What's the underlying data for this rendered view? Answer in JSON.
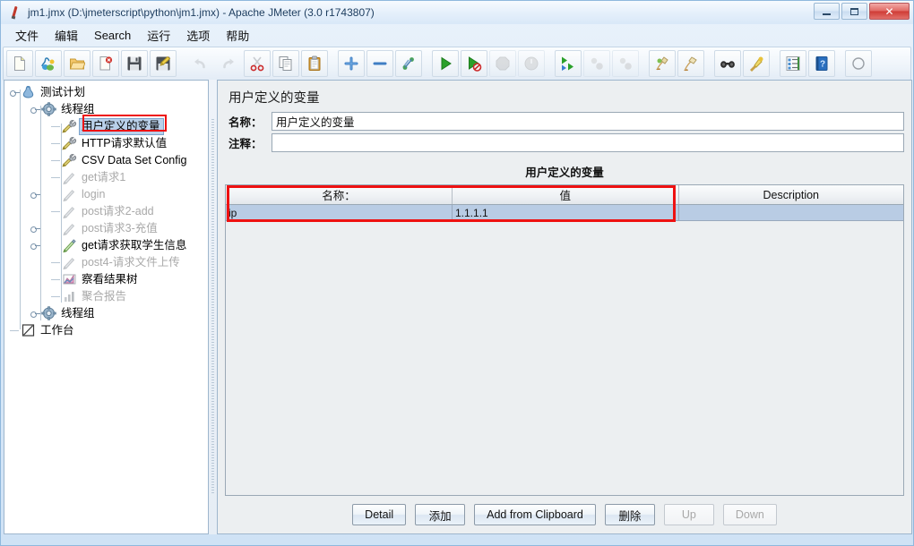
{
  "window": {
    "title": "jm1.jmx (D:\\jmeterscript\\python\\jm1.jmx) - Apache JMeter (3.0 r1743807)",
    "icon": "jmeter-feather-icon",
    "controls": {
      "minimize": "Minimize",
      "maximize": "Maximize",
      "close": "Close"
    }
  },
  "menubar": {
    "items": [
      {
        "label": "文件",
        "name": "menu-file"
      },
      {
        "label": "编辑",
        "name": "menu-edit"
      },
      {
        "label": "Search",
        "name": "menu-search"
      },
      {
        "label": "运行",
        "name": "menu-run"
      },
      {
        "label": "选项",
        "name": "menu-options"
      },
      {
        "label": "帮助",
        "name": "menu-help"
      }
    ]
  },
  "toolbar": {
    "buttons": [
      {
        "name": "new-icon",
        "enabled": true
      },
      {
        "name": "templates-icon",
        "enabled": true
      },
      {
        "name": "open-icon",
        "enabled": true
      },
      {
        "name": "close-icon",
        "enabled": true
      },
      {
        "name": "save-icon",
        "enabled": true
      },
      {
        "name": "save-as-icon",
        "enabled": true
      },
      {
        "name": "undo-icon",
        "enabled": false
      },
      {
        "name": "redo-icon",
        "enabled": false
      },
      {
        "name": "cut-icon",
        "enabled": true
      },
      {
        "name": "copy-icon",
        "enabled": true
      },
      {
        "name": "paste-icon",
        "enabled": true
      },
      {
        "name": "expand-all-icon",
        "enabled": true
      },
      {
        "name": "collapse-all-icon",
        "enabled": true
      },
      {
        "name": "toggle-icon",
        "enabled": true
      },
      {
        "name": "start-icon",
        "enabled": true
      },
      {
        "name": "start-no-pauses-icon",
        "enabled": true
      },
      {
        "name": "stop-icon",
        "enabled": false
      },
      {
        "name": "shutdown-icon",
        "enabled": false
      },
      {
        "name": "start-remote-all-icon",
        "enabled": true
      },
      {
        "name": "stop-remote-all-icon",
        "enabled": false
      },
      {
        "name": "shutdown-remote-all-icon",
        "enabled": false
      },
      {
        "name": "clear-icon",
        "enabled": true
      },
      {
        "name": "clear-all-icon",
        "enabled": true
      },
      {
        "name": "search-icon",
        "enabled": true
      },
      {
        "name": "search-reset-icon",
        "enabled": true
      },
      {
        "name": "function-helper-icon",
        "enabled": true
      },
      {
        "name": "help-icon",
        "enabled": true
      }
    ]
  },
  "tree": {
    "nodes": [
      {
        "label": "测试计划",
        "icon": "test-plan-icon",
        "depth": 0,
        "handle": "knob",
        "enabled": true,
        "selected": false
      },
      {
        "label": "线程组",
        "icon": "thread-group-icon",
        "depth": 1,
        "handle": "knob",
        "enabled": true,
        "selected": false
      },
      {
        "label": "用户定义的变量",
        "icon": "config-element-icon",
        "depth": 2,
        "handle": "leaf",
        "enabled": true,
        "selected": true
      },
      {
        "label": "HTTP请求默认值",
        "icon": "config-element-icon",
        "depth": 2,
        "handle": "leaf",
        "enabled": true,
        "selected": false
      },
      {
        "label": "CSV Data Set Config",
        "icon": "config-element-icon",
        "depth": 2,
        "handle": "leaf",
        "enabled": true,
        "selected": false
      },
      {
        "label": "get请求1",
        "icon": "http-sampler-icon",
        "depth": 2,
        "handle": "leaf",
        "enabled": false,
        "selected": false
      },
      {
        "label": "login",
        "icon": "http-sampler-icon",
        "depth": 2,
        "handle": "knob",
        "enabled": false,
        "selected": false
      },
      {
        "label": "post请求2-add",
        "icon": "http-sampler-icon",
        "depth": 2,
        "handle": "leaf",
        "enabled": false,
        "selected": false
      },
      {
        "label": "post请求3-充值",
        "icon": "http-sampler-icon",
        "depth": 2,
        "handle": "knob",
        "enabled": false,
        "selected": false
      },
      {
        "label": "get请求获取学生信息",
        "icon": "http-sampler-icon",
        "depth": 2,
        "handle": "knob",
        "enabled": true,
        "selected": false
      },
      {
        "label": "post4-请求文件上传",
        "icon": "http-sampler-icon",
        "depth": 2,
        "handle": "leaf",
        "enabled": false,
        "selected": false
      },
      {
        "label": "察看结果树",
        "icon": "view-results-tree-icon",
        "depth": 2,
        "handle": "leaf",
        "enabled": true,
        "selected": false
      },
      {
        "label": "聚合报告",
        "icon": "aggregate-report-icon",
        "depth": 2,
        "handle": "leaf",
        "enabled": false,
        "selected": false
      },
      {
        "label": "线程组",
        "icon": "thread-group-icon",
        "depth": 1,
        "handle": "knob",
        "enabled": true,
        "selected": false
      },
      {
        "label": "工作台",
        "icon": "workbench-icon",
        "depth": 0,
        "handle": "leaf",
        "enabled": true,
        "selected": false
      }
    ]
  },
  "panel": {
    "title": "用户定义的变量",
    "name_label": "名称：",
    "name_value": "用户定义的变量",
    "comment_label": "注释：",
    "comment_value": "",
    "table_caption": "用户定义的变量"
  },
  "table": {
    "columns": [
      "名称：",
      "值",
      "Description"
    ],
    "rows": [
      {
        "name": "ip",
        "value": "1.1.1.1",
        "description": ""
      }
    ]
  },
  "buttons": [
    {
      "label": "Detail",
      "name": "detail-button",
      "enabled": true
    },
    {
      "label": "添加",
      "name": "add-button",
      "enabled": true
    },
    {
      "label": "Add from Clipboard",
      "name": "add-from-clipboard-button",
      "enabled": true
    },
    {
      "label": "删除",
      "name": "delete-button",
      "enabled": true
    },
    {
      "label": "Up",
      "name": "up-button",
      "enabled": false
    },
    {
      "label": "Down",
      "name": "down-button",
      "enabled": false
    }
  ],
  "annotations": {
    "accent_color": "#ee1111",
    "boxes": [
      "tree-selected-node-highlight",
      "table-name-value-columns-highlight"
    ]
  },
  "colors": {
    "selection_blue": "#b9cce4",
    "tree_selection": "#b9d0ea",
    "panel_bg": "#eceff1",
    "window_frame": "#cfe2f5"
  }
}
